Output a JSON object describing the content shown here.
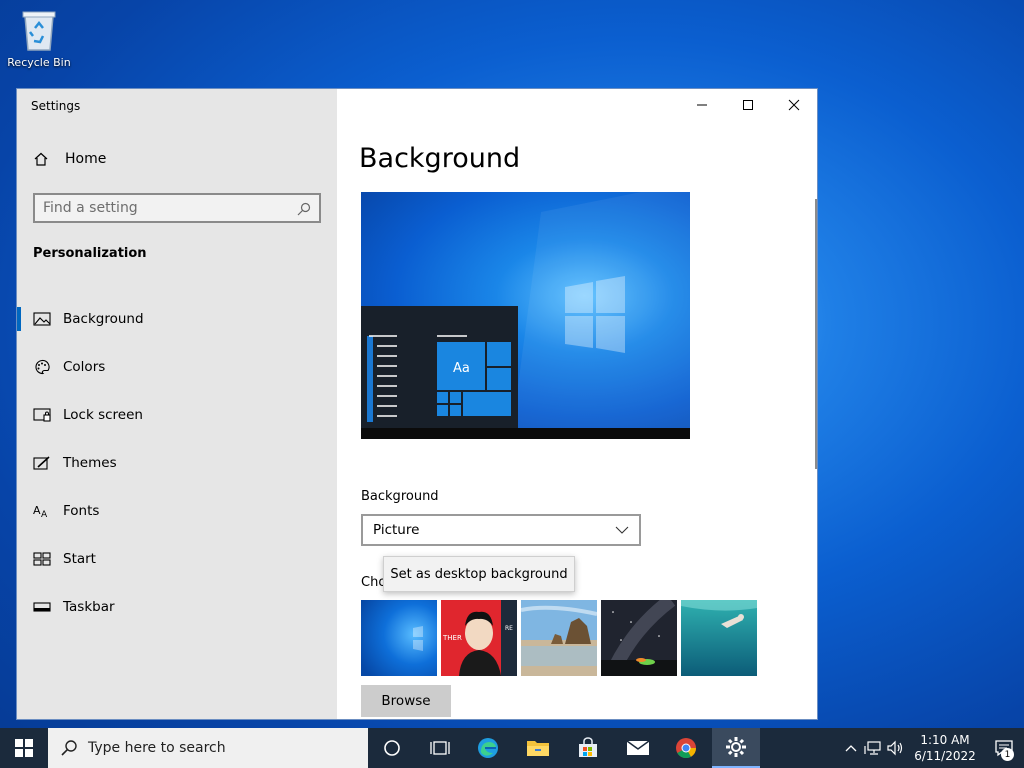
{
  "desktop": {
    "recycle_bin_label": "Recycle Bin"
  },
  "window": {
    "title": "Settings",
    "controls": [
      "minimize",
      "maximize",
      "close"
    ]
  },
  "sidebar": {
    "home_label": "Home",
    "search_placeholder": "Find a setting",
    "section_title": "Personalization",
    "items": [
      {
        "label": "Background",
        "icon": "picture-icon",
        "active": true
      },
      {
        "label": "Colors",
        "icon": "palette-icon",
        "active": false
      },
      {
        "label": "Lock screen",
        "icon": "lock-screen-icon",
        "active": false
      },
      {
        "label": "Themes",
        "icon": "themes-icon",
        "active": false
      },
      {
        "label": "Fonts",
        "icon": "fonts-icon",
        "active": false
      },
      {
        "label": "Start",
        "icon": "start-icon",
        "active": false
      },
      {
        "label": "Taskbar",
        "icon": "taskbar-icon",
        "active": false
      }
    ]
  },
  "content": {
    "title": "Background",
    "preview_sample_text": "Aa",
    "background_label": "Background",
    "background_value": "Picture",
    "choose_label": "Cho",
    "context_menu_item": "Set as desktop background",
    "browse_label": "Browse",
    "thumbnails": [
      "windows-blue",
      "portrait-red",
      "beach-rocks",
      "milky-way-night",
      "underwater-swimmer"
    ],
    "thumb2_text_left": "THER",
    "thumb2_text_right": "RE"
  },
  "taskbar": {
    "search_placeholder": "Type here to search",
    "apps": [
      "cortana-icon",
      "task-view-icon",
      "edge-icon",
      "file-explorer-icon",
      "store-icon",
      "mail-icon",
      "chrome-icon",
      "settings-icon"
    ],
    "clock_time": "1:10 AM",
    "clock_date": "6/11/2022",
    "notification_count": "1"
  },
  "colors": {
    "accent": "#0067c0",
    "sidebar_bg": "#e6e6e6",
    "taskbar_bg": "#1b2a3c"
  }
}
